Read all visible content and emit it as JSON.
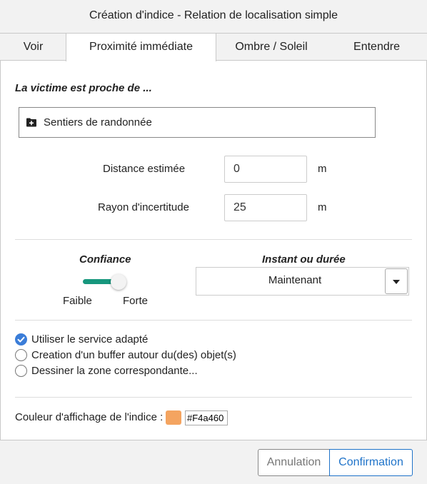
{
  "window": {
    "title": "Création d'indice - Relation de localisation simple"
  },
  "tabs": [
    {
      "label": "Voir"
    },
    {
      "label": "Proximité immédiate",
      "active": true
    },
    {
      "label": "Ombre / Soleil"
    },
    {
      "label": "Entendre"
    }
  ],
  "section": {
    "heading": "La victime est proche de ...",
    "layer": {
      "icon": "folder-plus-icon",
      "label": "Sentiers de randonnée"
    }
  },
  "distance": {
    "label": "Distance estimée",
    "value": "0",
    "unit": "m"
  },
  "radius": {
    "label": "Rayon d'incertitude",
    "value": "25",
    "unit": "m"
  },
  "confidence": {
    "title": "Confiance",
    "min_label": "Faible",
    "max_label": "Forte",
    "level": 1.0,
    "color": "#17977d"
  },
  "timing": {
    "title": "Instant ou durée",
    "selected": "Maintenant",
    "icon": "caret-down-icon"
  },
  "options": [
    {
      "label": "Utiliser le service adapté",
      "checked": true
    },
    {
      "label": "Creation d'un buffer autour du(des) objet(s)",
      "checked": false
    },
    {
      "label": "Dessiner la zone correspondante...",
      "checked": false
    }
  ],
  "color": {
    "label": "Couleur d'affichage de l'indice :",
    "hex": "#F4a460",
    "swatch": "#f4a460"
  },
  "footer": {
    "cancel_label": "Annulation",
    "confirm_label": "Confirmation",
    "accent": "#1f73c9"
  }
}
